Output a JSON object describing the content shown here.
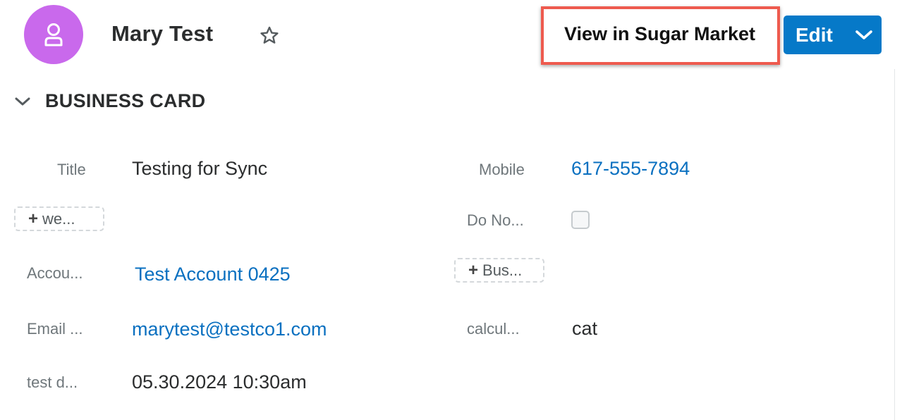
{
  "header": {
    "record_name": "Mary Test",
    "avatar_icon": "contact-person-icon",
    "avatar_color": "#c969ec",
    "favorite_icon": "star-outline-icon",
    "sugar_market_label": "View in Sugar Market",
    "edit_label": "Edit",
    "edit_dropdown_icon": "chevron-down-icon",
    "primary_color": "#0679c8",
    "highlight_color": "#ee5a4e"
  },
  "panel": {
    "title": "BUSINESS CARD",
    "toggle_icon": "chevron-down-icon"
  },
  "fields": {
    "title": {
      "label": "Title",
      "value": "Testing for Sync"
    },
    "mobile": {
      "label": "Mobile",
      "value": "617-555-7894"
    },
    "website_add": "we...",
    "do_not_call": {
      "label": "Do No...",
      "checked": false
    },
    "account": {
      "label": "Accou...",
      "value": "Test Account 0425"
    },
    "business_add": "Bus...",
    "email": {
      "label": "Email ...",
      "value": "marytest@testco1.com"
    },
    "calculated": {
      "label": "calcul...",
      "value": "cat"
    },
    "test_date": {
      "label": "test d...",
      "value": "05.30.2024 10:30am"
    }
  },
  "link_color": "#0a70c0"
}
